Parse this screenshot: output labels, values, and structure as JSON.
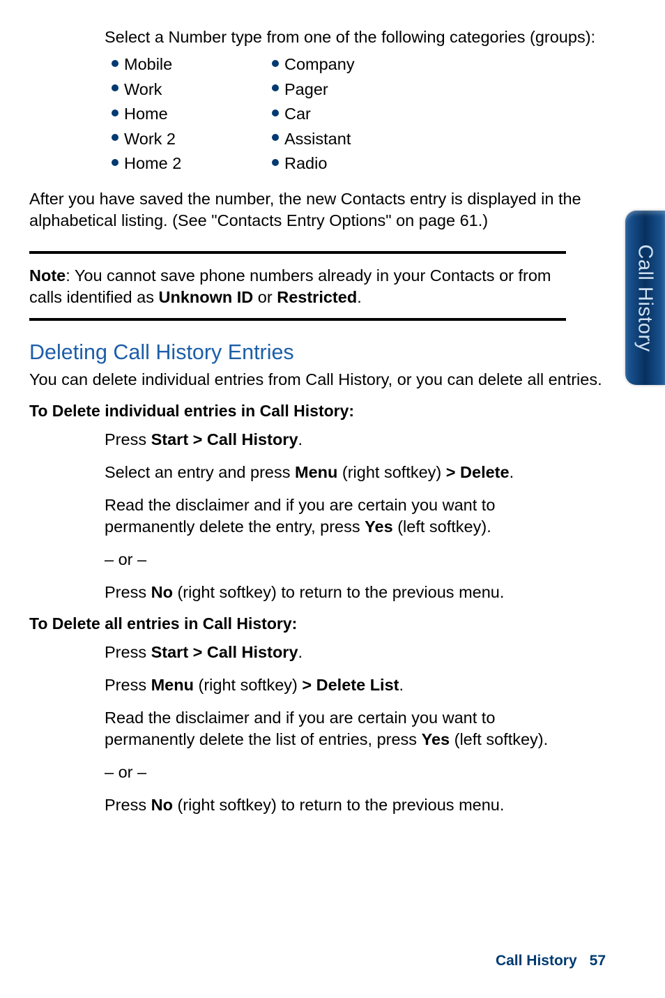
{
  "intro": "Select a Number type from one of the following categories (groups):",
  "number_types": {
    "left": [
      "Mobile",
      "Work",
      "Home",
      "Work 2",
      "Home 2"
    ],
    "right": [
      "Company",
      "Pager",
      "Car",
      "Assistant",
      "Radio"
    ]
  },
  "after_save": "After you have saved the number, the new Contacts entry is displayed in the alphabetical listing. (See \"Contacts Entry Options\" on page 61.)",
  "note": {
    "label": "Note",
    "before_bold": ": You cannot save phone numbers already in your Contacts or from calls identified as ",
    "bold1": "Unknown ID",
    "mid": " or ",
    "bold2": "Restricted",
    "after": "."
  },
  "section": {
    "heading": "Deleting Call History Entries",
    "sub": "You can delete individual entries from Call History, or you can delete all entries."
  },
  "del_individual": {
    "heading": "To Delete individual entries in Call History:",
    "step1": {
      "a": "Press ",
      "b": "Start > Call History",
      "c": "."
    },
    "step2": {
      "a": "Select an entry and press ",
      "b": "Menu",
      "c": " (right softkey) ",
      "d": "> Delete",
      "e": "."
    },
    "step3": {
      "a": "Read the disclaimer and if you are certain you want to permanently delete the entry, press ",
      "b": "Yes",
      "c": " (left softkey)."
    },
    "or": "– or –",
    "step4": {
      "a": "Press ",
      "b": "No",
      "c": " (right softkey) to return to the previous menu."
    }
  },
  "del_all": {
    "heading": "To Delete all entries in Call History:",
    "step1": {
      "a": "Press ",
      "b": "Start > Call History",
      "c": "."
    },
    "step2": {
      "a": "Press ",
      "b": "Menu",
      "c": " (right softkey) ",
      "d": "> Delete List",
      "e": "."
    },
    "step3": {
      "a": "Read the disclaimer and if you are certain you want to permanently delete the list of entries, press ",
      "b": "Yes",
      "c": " (left softkey)."
    },
    "or": "– or –",
    "step4": {
      "a": "Press ",
      "b": "No",
      "c": " (right softkey) to return to the previous menu."
    }
  },
  "side_tab": "Call History",
  "footer": {
    "label": "Call History",
    "page": "57"
  }
}
